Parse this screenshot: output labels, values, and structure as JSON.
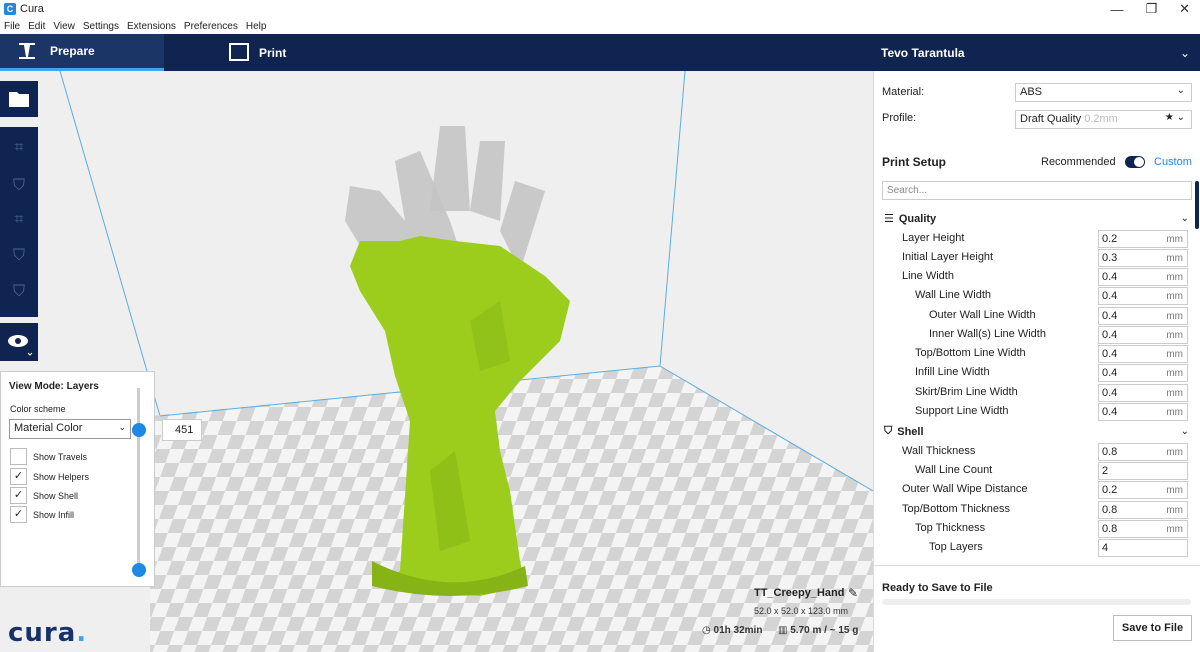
{
  "window": {
    "title": "Cura",
    "minimize": "—",
    "maximize": "❐",
    "close": "✕"
  },
  "menu": [
    "File",
    "Edit",
    "View",
    "Settings",
    "Extensions",
    "Preferences",
    "Help"
  ],
  "tabs": {
    "prepare": "Prepare",
    "print": "Print"
  },
  "printer": {
    "name": "Tevo Tarantula"
  },
  "layer_view": {
    "title": "View Mode: Layers",
    "color_scheme_label": "Color scheme",
    "color_scheme_value": "Material Color",
    "layer_number": "451",
    "checkboxes": [
      {
        "label": "Show Travels",
        "checked": false
      },
      {
        "label": "Show Helpers",
        "checked": true
      },
      {
        "label": "Show Shell",
        "checked": true
      },
      {
        "label": "Show Infill",
        "checked": true
      }
    ]
  },
  "logo": {
    "text": "cura",
    "dot": "."
  },
  "model": {
    "name": "TT_Creepy_Hand",
    "dimensions": "52.0 x 52.0 x 123.0 mm",
    "print_time": "01h 32min",
    "material_usage": "5.70 m / ~ 15 g"
  },
  "right_panel": {
    "material_label": "Material:",
    "material_value": "ABS",
    "profile_label": "Profile:",
    "profile_value": "Draft Quality",
    "profile_sub": "0.2mm",
    "print_setup": "Print Setup",
    "mode_recommended": "Recommended",
    "mode_custom": "Custom",
    "search_placeholder": "Search...",
    "sections": [
      {
        "title": "Quality"
      },
      {
        "title": "Shell"
      }
    ],
    "quality_settings": [
      {
        "label": "Layer Height",
        "value": "0.2",
        "unit": "mm"
      },
      {
        "label": "Initial Layer Height",
        "value": "0.3",
        "unit": "mm"
      },
      {
        "label": "Line Width",
        "value": "0.4",
        "unit": "mm"
      },
      {
        "label": "Wall Line Width",
        "value": "0.4",
        "unit": "mm"
      },
      {
        "label": "Outer Wall Line Width",
        "value": "0.4",
        "unit": "mm"
      },
      {
        "label": "Inner Wall(s) Line Width",
        "value": "0.4",
        "unit": "mm"
      },
      {
        "label": "Top/Bottom Line Width",
        "value": "0.4",
        "unit": "mm"
      },
      {
        "label": "Infill Line Width",
        "value": "0.4",
        "unit": "mm"
      },
      {
        "label": "Skirt/Brim Line Width",
        "value": "0.4",
        "unit": "mm"
      },
      {
        "label": "Support Line Width",
        "value": "0.4",
        "unit": "mm"
      }
    ],
    "shell_settings": [
      {
        "label": "Wall Thickness",
        "value": "0.8",
        "unit": "mm"
      },
      {
        "label": "Wall Line Count",
        "value": "2",
        "unit": ""
      },
      {
        "label": "Outer Wall Wipe Distance",
        "value": "0.2",
        "unit": "mm"
      },
      {
        "label": "Top/Bottom Thickness",
        "value": "0.8",
        "unit": "mm"
      },
      {
        "label": "Top Thickness",
        "value": "0.8",
        "unit": "mm"
      },
      {
        "label": "Top Layers",
        "value": "4",
        "unit": ""
      }
    ],
    "ready_text": "Ready to Save to File",
    "save_button": "Save to File"
  },
  "colors": {
    "header": "#0f2451",
    "accent": "#3ea6e6",
    "model": "#9ccc1c",
    "link": "#1e88e5"
  }
}
